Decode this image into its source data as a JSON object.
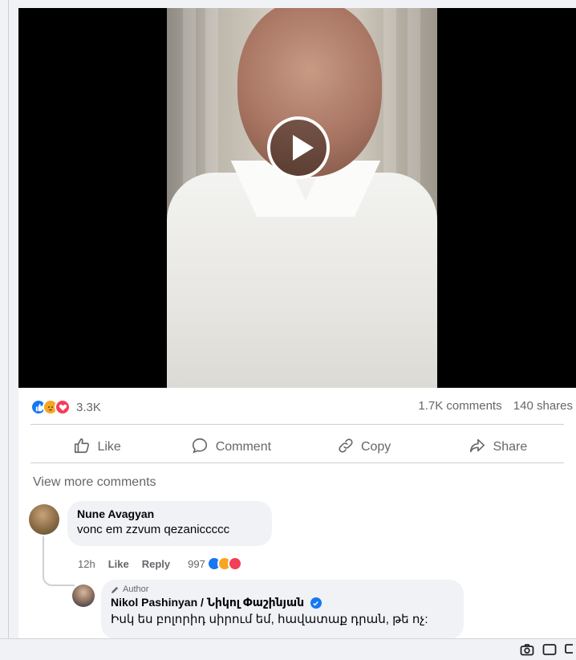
{
  "video": {
    "play_icon": "play-icon"
  },
  "stats": {
    "reaction_icons": [
      "like-icon",
      "angry-icon",
      "love-icon"
    ],
    "reaction_count": "3.3K",
    "comments": "1.7K comments",
    "shares": "140 shares"
  },
  "actions": [
    {
      "label": "Like",
      "icon": "thumbs-up-icon"
    },
    {
      "label": "Comment",
      "icon": "comment-icon"
    },
    {
      "label": "Copy",
      "icon": "link-icon"
    },
    {
      "label": "Share",
      "icon": "share-icon"
    }
  ],
  "view_more": "View more comments",
  "comments": [
    {
      "author": "Nune Avagyan",
      "text": "vonc em zzvum qezaniccccc",
      "time": "12h",
      "like_label": "Like",
      "reply_label": "Reply",
      "reaction_count": "997"
    }
  ],
  "reply": {
    "badge": "Author",
    "author": "Nikol Pashinyan / Նիկոլ Փաշինյան",
    "text": "Իսկ ես բոլորիդ սիրում եմ, հավատաք դրան, թե ոչ:"
  },
  "colors": {
    "accent": "#1877f2",
    "love": "#f33e58",
    "angry": "#f5a623",
    "muted": "#65676b"
  }
}
